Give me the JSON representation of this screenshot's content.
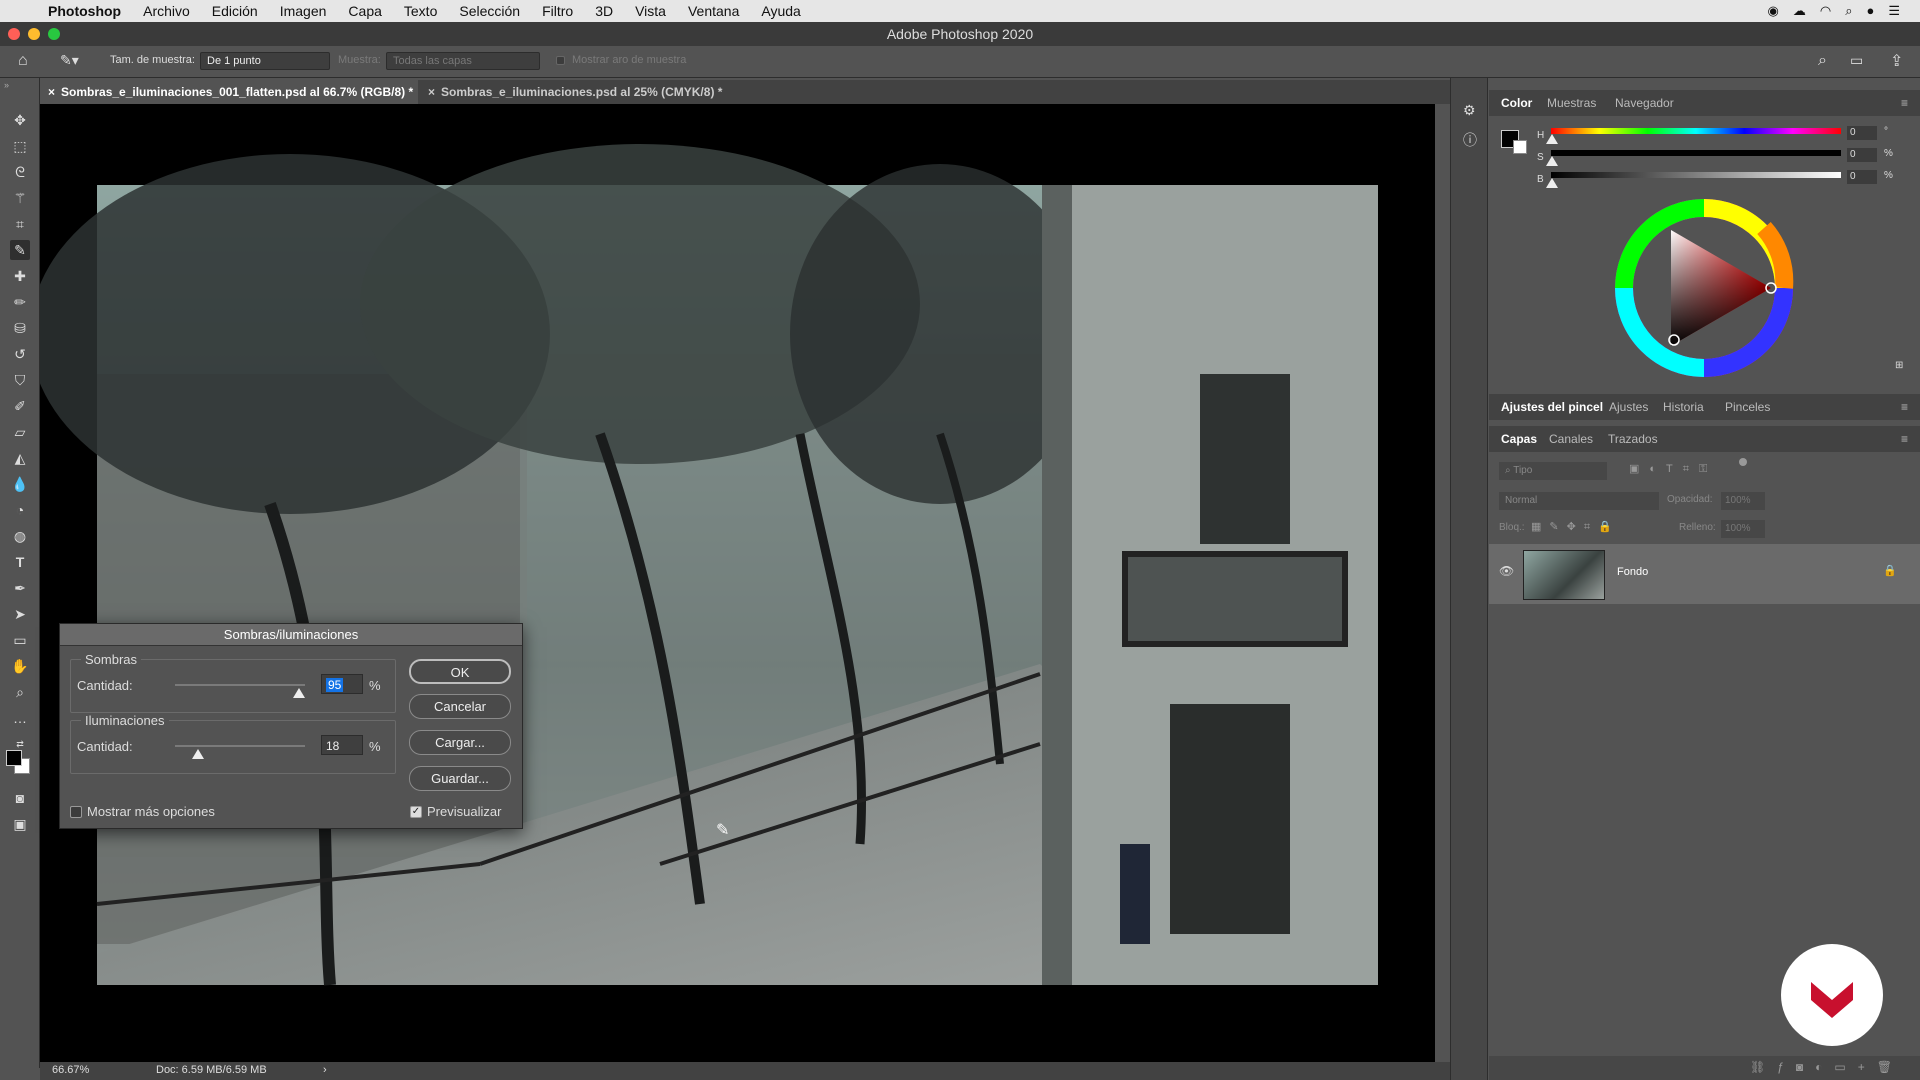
{
  "menubar": {
    "app": "Photoshop",
    "items": [
      "Archivo",
      "Edición",
      "Imagen",
      "Capa",
      "Texto",
      "Selección",
      "Filtro",
      "3D",
      "Vista",
      "Ventana",
      "Ayuda"
    ]
  },
  "window": {
    "title": "Adobe Photoshop 2020"
  },
  "options": {
    "sample_size_label": "Tam. de muestra:",
    "sample_size_value": "De 1 punto",
    "sample_label": "Muestra:",
    "sample_value": "Todas las capas",
    "show_ring_label": "Mostrar aro de muestra"
  },
  "tabs": [
    {
      "label": "Sombras_e_iluminaciones_001_flatten.psd al 66.7% (RGB/8) *"
    },
    {
      "label": "Sombras_e_iluminaciones.psd al 25% (CMYK/8) *"
    }
  ],
  "status": {
    "zoom": "66.67%",
    "doc": "Doc: 6.59 MB/6.59 MB"
  },
  "color_panel": {
    "tabs": [
      "Color",
      "Muestras",
      "Navegador"
    ],
    "h_label": "H",
    "s_label": "S",
    "b_label": "B",
    "h_value": "0",
    "s_value": "0",
    "b_value": "0",
    "h_unit": "°",
    "s_unit": "%",
    "b_unit": "%"
  },
  "brush_panel": {
    "tabs": [
      "Ajustes del pincel",
      "Ajustes",
      "Historia",
      "Pinceles"
    ]
  },
  "layers_panel": {
    "tabs": [
      "Capas",
      "Canales",
      "Trazados"
    ],
    "filter_placeholder": "Tipo",
    "blend_mode": "Normal",
    "opacity_label": "Opacidad:",
    "opacity_value": "100%",
    "lock_label": "Bloq.:",
    "fill_label": "Relleno:",
    "fill_value": "100%",
    "layers": [
      {
        "name": "Fondo"
      }
    ]
  },
  "dialog": {
    "title": "Sombras/iluminaciones",
    "shadows_label": "Sombras",
    "shadows_amount_label": "Cantidad:",
    "shadows_value": "95",
    "shadows_amount": 0.95,
    "highlights_label": "Iluminaciones",
    "highlights_amount_label": "Cantidad:",
    "highlights_value": "18",
    "highlights_amount": 0.18,
    "percent": "%",
    "ok": "OK",
    "cancel": "Cancelar",
    "load": "Cargar...",
    "save": "Guardar...",
    "more_options": "Mostrar más opciones",
    "preview": "Previsualizar"
  },
  "colors": {
    "accent": "#1473e6",
    "logo": "#c8102e"
  }
}
